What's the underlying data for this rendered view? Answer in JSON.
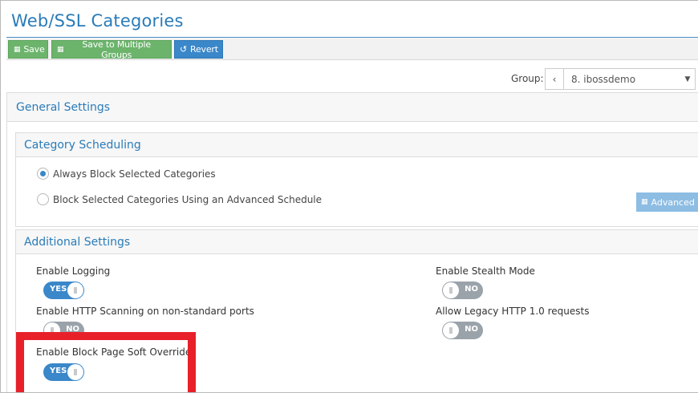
{
  "page": {
    "title": "Web/SSL Categories"
  },
  "toolbar": {
    "save_label": "Save",
    "save_multi_label": "Save to Multiple Groups",
    "revert_label": "Revert"
  },
  "group": {
    "label": "Group:",
    "prev": "‹",
    "value": "8. ibossdemo",
    "caret": "▼"
  },
  "general": {
    "title": "General Settings"
  },
  "scheduling": {
    "title": "Category Scheduling",
    "options": [
      {
        "label": "Always Block Selected Categories",
        "selected": true
      },
      {
        "label": "Block Selected Categories Using an Advanced Schedule",
        "selected": false
      }
    ],
    "advanced_button": "Advanced S"
  },
  "additional": {
    "title": "Additional Settings",
    "settings": [
      {
        "label": "Enable Logging",
        "state": "YES"
      },
      {
        "label": "Enable Stealth Mode",
        "state": "NO"
      },
      {
        "label": "Enable HTTP Scanning on non-standard ports",
        "state": "NO"
      },
      {
        "label": "Allow Legacy HTTP 1.0 requests",
        "state": "NO"
      },
      {
        "label": "Enable Block Page Soft Override",
        "state": "YES"
      }
    ]
  },
  "colors": {
    "accent": "#2a7bb8",
    "green": "#6cb46c",
    "blue": "#3a87c9",
    "highlight": "#e8202a"
  },
  "icons": {
    "save": "floppy-icon",
    "revert": "undo-icon",
    "calendar": "calendar-icon"
  }
}
